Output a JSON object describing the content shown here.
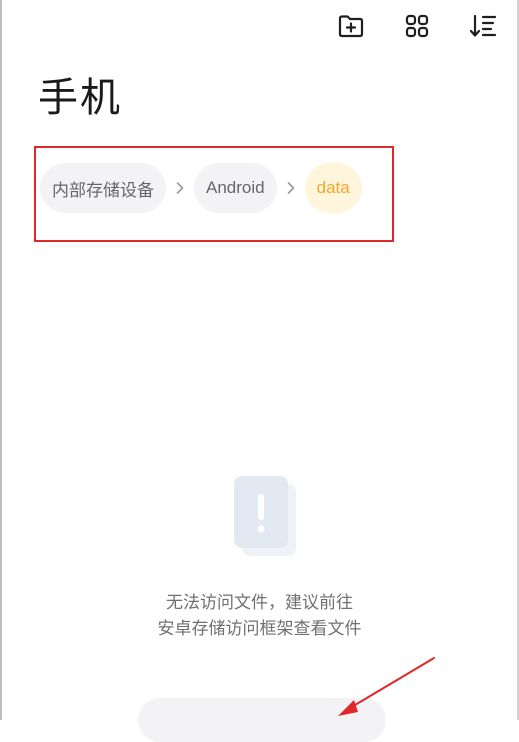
{
  "header": {
    "title": "手机",
    "actions": [
      {
        "name": "new-folder",
        "icon": "new-folder-icon"
      },
      {
        "name": "grid-view",
        "icon": "grid-view-icon"
      },
      {
        "name": "sort",
        "icon": "sort-icon"
      }
    ]
  },
  "breadcrumb": {
    "items": [
      {
        "label": "内部存储设备",
        "active": false
      },
      {
        "label": "Android",
        "active": false
      },
      {
        "label": "data",
        "active": true
      }
    ],
    "separator_icon": "chevron-right-icon"
  },
  "empty_state": {
    "icon": "warning-file-icon",
    "message_line1": "无法访问文件，建议前往",
    "message_line2": "安卓存储访问框架查看文件"
  },
  "annotation": {
    "highlight_color": "#e0272a",
    "arrow_color": "#e0272a"
  },
  "colors": {
    "accent": "#f0a92a",
    "crumb_bg": "#f3f3f5",
    "active_crumb_bg": "#fff4dc"
  }
}
